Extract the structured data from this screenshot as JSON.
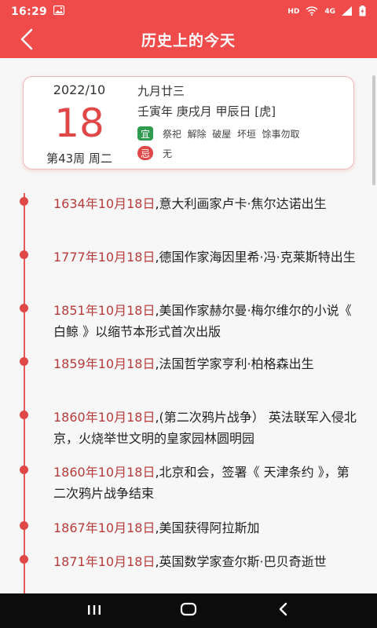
{
  "status": {
    "time": "16:29",
    "network_label": "HD",
    "signal_label": "4G",
    "battery_label": "battery"
  },
  "header": {
    "title": "历史上的今天",
    "back_icon": "chevron-left-icon"
  },
  "calendar": {
    "year_month": "2022/10",
    "day": "18",
    "week_info": "第43周   周二",
    "lunar": "九月廿三",
    "ganzhi": "壬寅年 庚戌月 甲辰日 [虎]",
    "yi_label": "宜",
    "yi_items": "祭祀  解除  破屋  坏垣  馀事勿取",
    "ji_label": "忌",
    "ji_items": "无"
  },
  "events": [
    {
      "date": "1634年10月18日",
      "desc": ",意大利画家卢卡·焦尔达诺出生"
    },
    {
      "date": "1777年10月18日",
      "desc": ",德国作家海因里希·冯·克莱斯特出生"
    },
    {
      "date": "1851年10月18日",
      "desc": ",美国作家赫尔曼·梅尔维尔的小说《 白鲸 》以缩节本形式首次出版"
    },
    {
      "date": "1859年10月18日",
      "desc": ",法国哲学家亨利·柏格森出生"
    },
    {
      "date": "1860年10月18日",
      "desc": ",(第二次鸦片战争） 英法联军入侵北京，火烧举世文明的皇家园林圆明园"
    },
    {
      "date": "1860年10月18日",
      "desc": ",北京和会，签署《 天津条约 》，第二次鸦片战争结束"
    },
    {
      "date": "1867年10月18日",
      "desc": ",美国获得阿拉斯加"
    },
    {
      "date": "1871年10月18日",
      "desc": ",英国数学家查尔斯·巴贝奇逝世"
    }
  ],
  "navbar": {
    "recents_icon": "recents-icon",
    "home_icon": "home-icon",
    "back_icon": "back-triangle-icon"
  },
  "colors": {
    "accent": "#ef4b4a",
    "date_text": "#b83b3b",
    "yi_badge": "#2e9b4f",
    "ji_badge": "#e04848"
  }
}
